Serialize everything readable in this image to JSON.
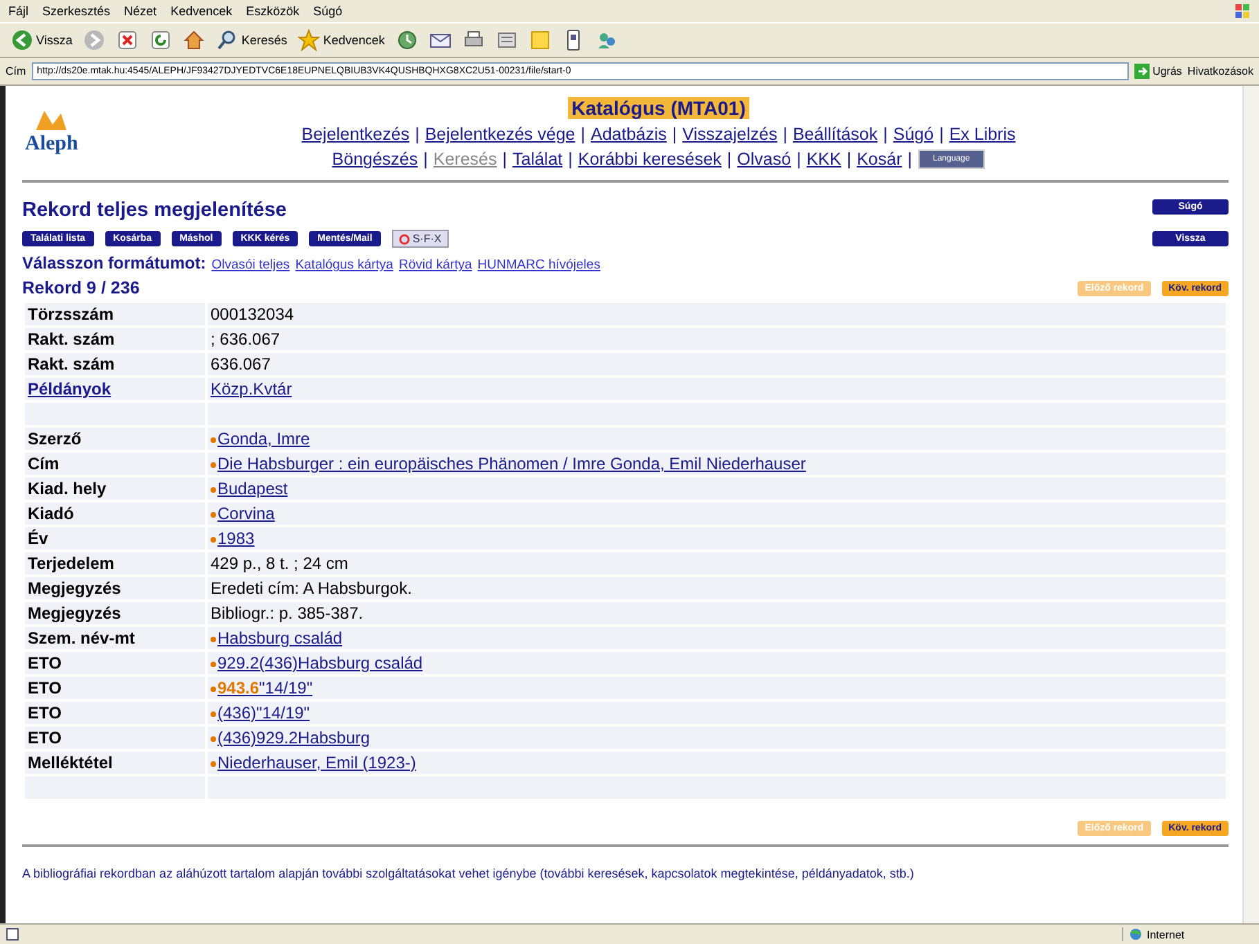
{
  "browser": {
    "menu": [
      "Fájl",
      "Szerkesztés",
      "Nézet",
      "Kedvencek",
      "Eszközök",
      "Súgó"
    ],
    "toolbar": [
      {
        "kind": "back",
        "label": "Vissza"
      },
      {
        "kind": "forward"
      },
      {
        "kind": "stop"
      },
      {
        "kind": "refresh"
      },
      {
        "kind": "home"
      },
      {
        "kind": "search",
        "label": "Keresés"
      },
      {
        "kind": "favorites",
        "label": "Kedvencek"
      },
      {
        "kind": "history"
      },
      {
        "kind": "mail"
      },
      {
        "kind": "print"
      },
      {
        "kind": "edit"
      },
      {
        "kind": "note"
      },
      {
        "kind": "device"
      },
      {
        "kind": "people"
      }
    ],
    "address_label": "Cím",
    "url": "http://ds20e.mtak.hu:4545/ALEPH/JF93427DJYEDTVC6E18EUPNELQBIUB3VK4QUSHBQHXG8XC2U51-00231/file/start-0",
    "go": "Ugrás",
    "links": "Hivatkozások",
    "status": "Internet"
  },
  "header": {
    "title": "Katalógus (MTA01)",
    "logo": "Aleph",
    "nav1": [
      {
        "label": "Bejelentkezés",
        "disabled": false
      },
      {
        "label": "Bejelentkezés vége",
        "disabled": false
      },
      {
        "label": "Adatbázis",
        "disabled": false
      },
      {
        "label": "Visszajelzés",
        "disabled": false
      },
      {
        "label": "Beállítások",
        "disabled": false
      },
      {
        "label": "Súgó",
        "disabled": false
      },
      {
        "label": "Ex Libris",
        "disabled": false
      }
    ],
    "nav2": [
      {
        "label": "Böngészés",
        "disabled": false
      },
      {
        "label": "Keresés",
        "disabled": true
      },
      {
        "label": "Találat",
        "disabled": false
      },
      {
        "label": "Korábbi keresések",
        "disabled": false
      },
      {
        "label": "Olvasó",
        "disabled": false
      },
      {
        "label": "KKK",
        "disabled": false
      },
      {
        "label": "Kosár",
        "disabled": false
      }
    ],
    "separator": "|",
    "language": "Language"
  },
  "page_title": "Rekord teljes megjelenítése",
  "actions": [
    "Találati lista",
    "Kosárba",
    "Máshol",
    "KKK kérés",
    "Mentés/Mail"
  ],
  "sfx": "S·F·X",
  "side_buttons": [
    "Súgó",
    "Vissza"
  ],
  "format_label": "Válasszon formátumot:",
  "formats": [
    "Olvasói teljes",
    "Katalógus kártya",
    "Rövid kártya",
    "HUNMARC hívójeles"
  ],
  "record": "Rekord 9 / 236",
  "pager_top": [
    {
      "label": "Előző rekord",
      "disabled": true
    },
    {
      "label": "Köv. rekord",
      "disabled": false
    }
  ],
  "rows": [
    {
      "kind": "field",
      "label": "Törzsszám",
      "value": "000132034",
      "label_link": false,
      "value_link": false,
      "bullet": false
    },
    {
      "kind": "field",
      "label": "Rakt. szám",
      "value": "; 636.067",
      "label_link": false,
      "value_link": false,
      "bullet": false
    },
    {
      "kind": "field",
      "label": "Rakt. szám",
      "value": "636.067",
      "label_link": false,
      "value_link": false,
      "bullet": false
    },
    {
      "kind": "field",
      "label": "Példányok",
      "value": "Közp.Kvtár",
      "label_link": true,
      "value_link": true,
      "bullet": false
    },
    {
      "kind": "spacer"
    },
    {
      "kind": "field",
      "label": "Szerző",
      "value": "Gonda, Imre",
      "label_link": false,
      "value_link": true,
      "bullet": true
    },
    {
      "kind": "field",
      "label": "Cím",
      "value": "Die Habsburger : ein europäisches Phänomen / Imre Gonda, Emil Niederhauser",
      "label_link": false,
      "value_link": true,
      "bullet": true
    },
    {
      "kind": "field",
      "label": "Kiad. hely",
      "value": "Budapest",
      "label_link": false,
      "value_link": true,
      "bullet": true
    },
    {
      "kind": "field",
      "label": "Kiadó",
      "value": "Corvina",
      "label_link": false,
      "value_link": true,
      "bullet": true
    },
    {
      "kind": "field",
      "label": "Év",
      "value": "1983",
      "label_link": false,
      "value_link": true,
      "bullet": true
    },
    {
      "kind": "field",
      "label": "Terjedelem",
      "value": "429 p., 8 t. ; 24 cm",
      "label_link": false,
      "value_link": false,
      "bullet": false
    },
    {
      "kind": "field",
      "label": "Megjegyzés",
      "value": "Eredeti cím: A Habsburgok.",
      "label_link": false,
      "value_link": false,
      "bullet": false
    },
    {
      "kind": "field",
      "label": "Megjegyzés",
      "value": "Bibliogr.: p. 385-387.",
      "label_link": false,
      "value_link": false,
      "bullet": false
    },
    {
      "kind": "field",
      "label": "Szem. név-mt",
      "value": "Habsburg család",
      "label_link": false,
      "value_link": true,
      "bullet": true
    },
    {
      "kind": "field",
      "label": "ETO",
      "value": "929.2(436)Habsburg család",
      "label_link": false,
      "value_link": true,
      "bullet": true
    },
    {
      "kind": "field",
      "label": "ETO",
      "value": "**943.6**\"14/19\"",
      "label_link": false,
      "value_link": true,
      "bullet": true
    },
    {
      "kind": "field",
      "label": "ETO",
      "value": "(436)\"14/19\"",
      "label_link": false,
      "value_link": true,
      "bullet": true
    },
    {
      "kind": "field",
      "label": "ETO",
      "value": "(436)929.2Habsburg",
      "label_link": false,
      "value_link": true,
      "bullet": true
    },
    {
      "kind": "field",
      "label": "Melléktétel",
      "value": "Niederhauser, Emil (1923-)",
      "label_link": false,
      "value_link": true,
      "bullet": true
    },
    {
      "kind": "spacer"
    }
  ],
  "pager_bottom": [
    {
      "label": "Előző rekord",
      "disabled": true
    },
    {
      "label": "Köv. rekord",
      "disabled": false
    }
  ],
  "footer": "A bibliográfiai rekordban az aláhúzott tartalom alapján további szolgáltatásokat vehet igénybe (további keresések, kapcsolatok megtekintése, példányadatok, stb.)"
}
